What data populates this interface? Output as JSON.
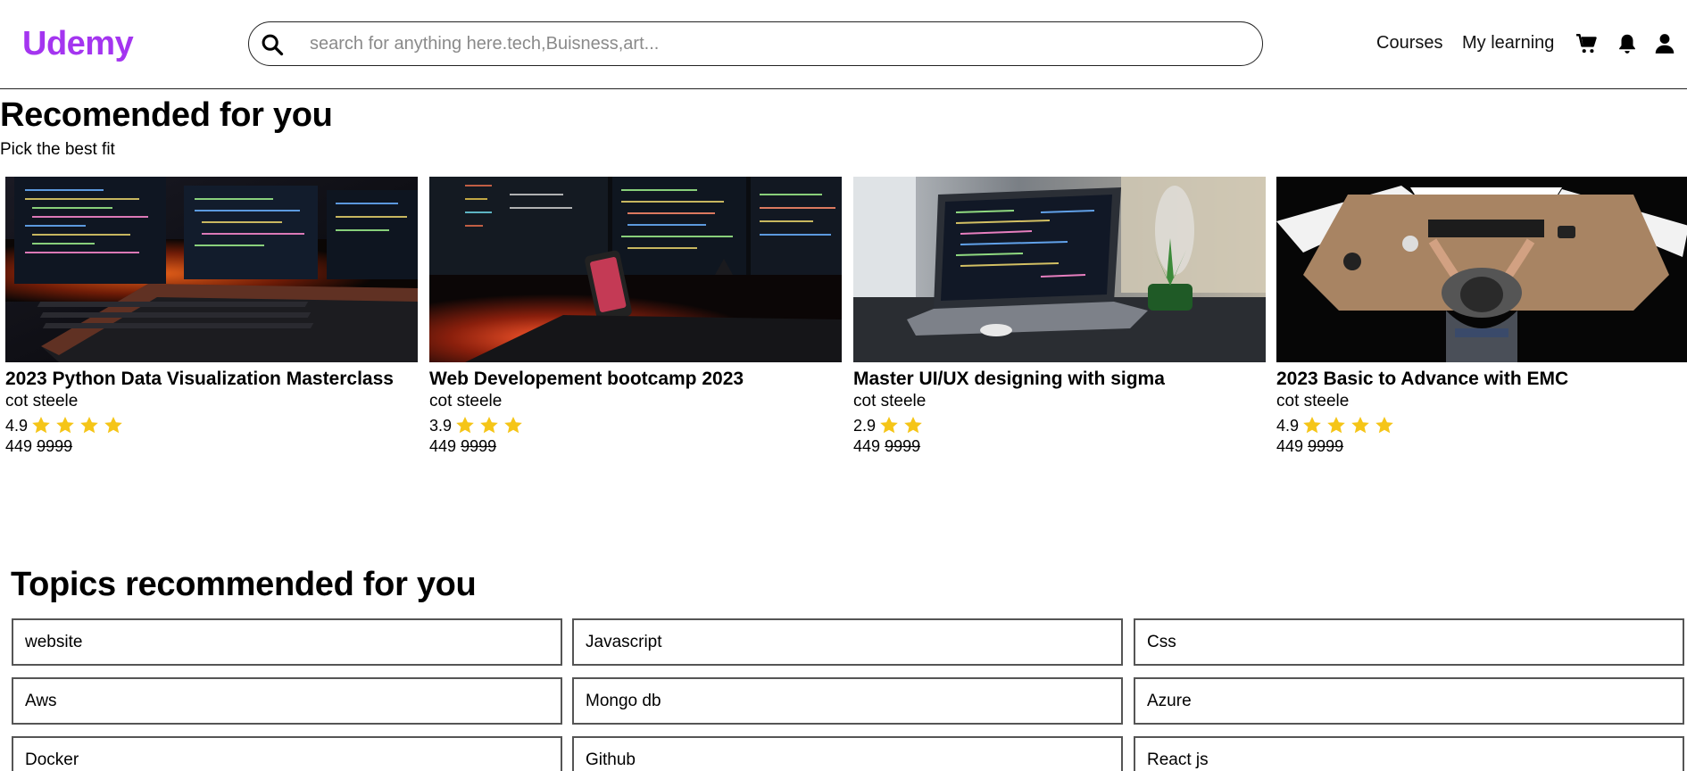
{
  "header": {
    "logo": "Udemy",
    "search_placeholder": "search for anything here.tech,Buisness,art...",
    "nav": {
      "courses": "Courses",
      "my_learning": "My learning"
    },
    "icons": [
      "search-icon",
      "cart-icon",
      "bell-icon",
      "user-icon"
    ]
  },
  "recommended": {
    "title": "Recomended for you",
    "subtitle": "Pick the best fit",
    "courses": [
      {
        "title": "2023 Python Data Visualization Masterclass",
        "author": "cot steele",
        "rating": "4.9",
        "stars": 4,
        "price": "449",
        "old_price": "9999"
      },
      {
        "title": "Web Developement bootcamp 2023",
        "author": "cot steele",
        "rating": "3.9",
        "stars": 3,
        "price": "449",
        "old_price": "9999"
      },
      {
        "title": "Master UI/UX designing with sigma",
        "author": "cot steele",
        "rating": "2.9",
        "stars": 2,
        "price": "449",
        "old_price": "9999"
      },
      {
        "title": "2023 Basic to Advance with EMC",
        "author": "cot steele",
        "rating": "4.9",
        "stars": 4,
        "price": "449",
        "old_price": "9999"
      }
    ]
  },
  "topics": {
    "title": "Topics recommended for you",
    "items": [
      "website",
      "Javascript",
      "Css",
      "Aws",
      "Mongo db",
      "Azure",
      "Docker",
      "Github",
      "React js"
    ]
  },
  "colors": {
    "brand": "#a435f0",
    "star": "#f5c518"
  }
}
